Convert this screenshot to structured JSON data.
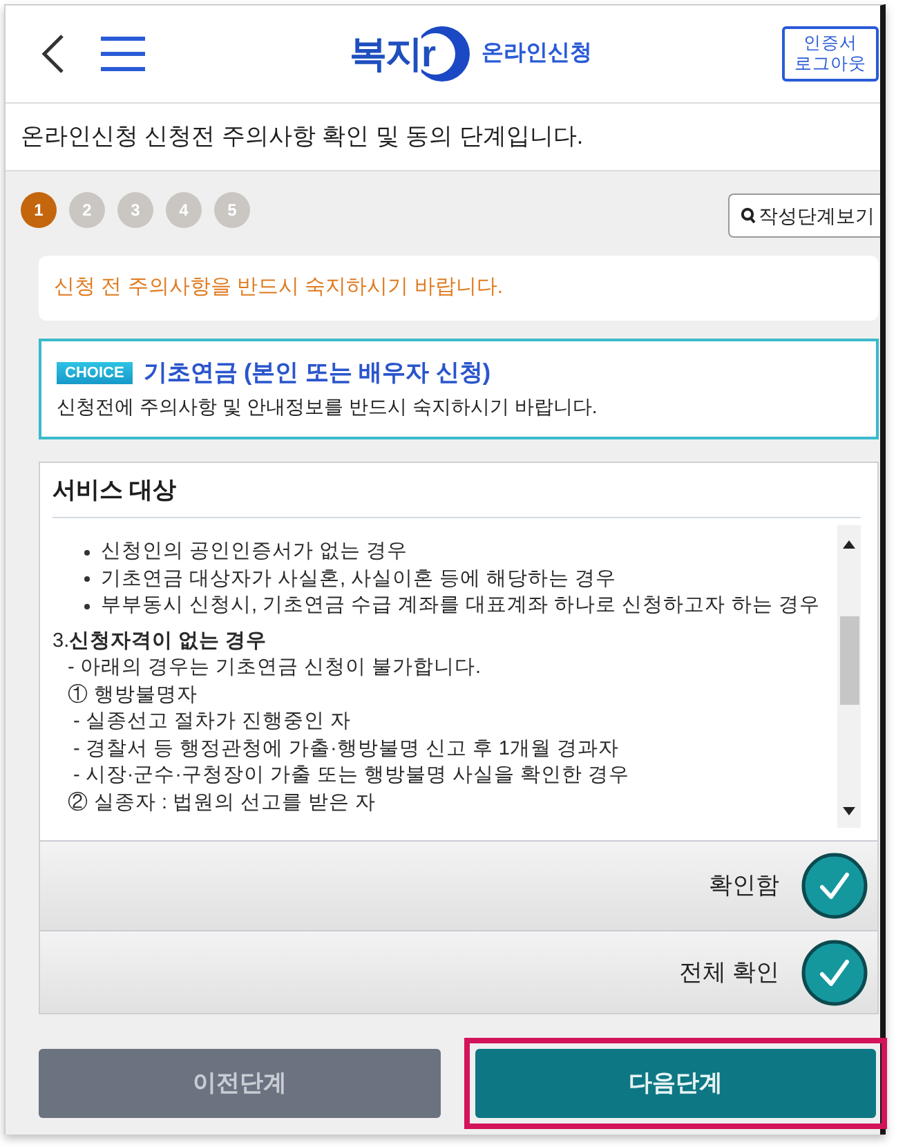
{
  "header": {
    "logo_text": "복지r",
    "service_name": "온라인신청",
    "logout_button": "인증서 로그아웃"
  },
  "subtitle": "온라인신청 신청전 주의사항 확인 및 동의 단계입니다.",
  "steps": [
    {
      "label": "1",
      "selected": true
    },
    {
      "label": "2",
      "selected": false
    },
    {
      "label": "3",
      "selected": false
    },
    {
      "label": "4",
      "selected": false
    },
    {
      "label": "5",
      "selected": false
    }
  ],
  "step_view_button": "작성단계보기",
  "notice": "신청 전 주의사항을 반드시 숙지하시기 바랍니다.",
  "choice": {
    "badge": "CHOICE",
    "title": "기초연금 (본인 또는 배우자 신청)",
    "description": "신청전에 주의사항 및 안내정보를 반드시 숙지하시기 바랍니다."
  },
  "service_panel": {
    "title": "서비스 대상",
    "lines": [
      {
        "kind": "bullet",
        "text": "신청인의 공인인증서가 없는 경우"
      },
      {
        "kind": "bullet",
        "text": "기초연금 대상자가 사실혼, 사실이혼 등에 해당하는 경우"
      },
      {
        "kind": "bullet",
        "text": "부부동시 신청시, 기초연금 수급 계좌를 대표계좌 하나로 신청하고자 하는 경우"
      },
      {
        "kind": "heading",
        "text": "3.**신청자격이 없는 경우**"
      },
      {
        "kind": "note",
        "text": "- 아래의 경우는 기초연금 신청이 불가합니다."
      },
      {
        "kind": "item",
        "text": "① 행방불명자"
      },
      {
        "kind": "subitem",
        "text": "- 실종선고 절차가 진행중인 자"
      },
      {
        "kind": "subitem",
        "text": "- 경찰서 등 행정관청에 가출·행방불명 신고 후 1개월 경과자"
      },
      {
        "kind": "subitem",
        "text": "- 시장·군수·구청장이 가출 또는 행방불명 사실을 확인한 경우"
      },
      {
        "kind": "item",
        "text": "② 실종자 : 법원의 선고를 받은 자"
      }
    ]
  },
  "confirmations": [
    {
      "label": "확인함",
      "checked": true
    },
    {
      "label": "전체 확인",
      "checked": true
    }
  ],
  "buttons": [
    {
      "label": "이전단계",
      "kind": "secondary"
    },
    {
      "label": "다음단계",
      "kind": "primary",
      "highlighted": true
    }
  ]
}
